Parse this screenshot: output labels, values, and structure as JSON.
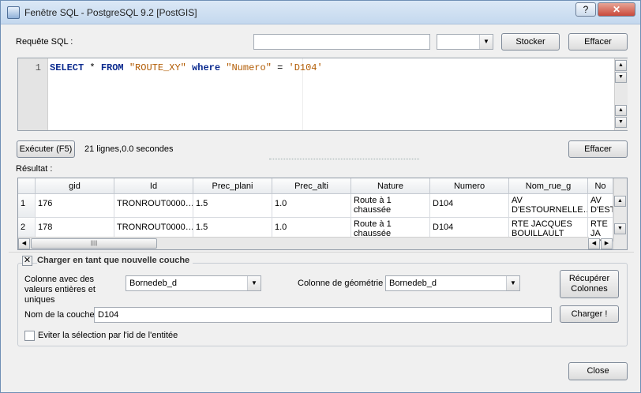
{
  "window": {
    "title": "Fenêtre SQL - PostgreSQL 9.2 [PostGIS]",
    "help_label": "?",
    "close_label": "✕"
  },
  "query": {
    "label": "Requête SQL :",
    "name_value": "",
    "combo_value": "",
    "store_label": "Stocker",
    "clear_label": "Effacer"
  },
  "editor": {
    "line_number": "1",
    "tokens": {
      "select": "SELECT",
      "star": " * ",
      "from": "FROM",
      "table": " \"ROUTE_XY\" ",
      "where": "where",
      "column": " \"Numero\" ",
      "eq": "= ",
      "value": "'D104'"
    }
  },
  "run": {
    "execute_label": "Exécuter (F5)",
    "status": "21 lignes,0.0 secondes",
    "clear_label": "Effacer"
  },
  "results": {
    "label": "Résultat :",
    "columns": [
      "gid",
      "Id",
      "Prec_plani",
      "Prec_alti",
      "Nature",
      "Numero",
      "Nom_rue_g",
      "No"
    ],
    "rows": [
      {
        "num": "1",
        "cells": [
          "176",
          "TRONROUT0000…",
          "1.5",
          "1.0",
          "Route à 1 chaussée",
          "D104",
          "AV D'ESTOURNELLE…",
          "AV D'ESTO"
        ]
      },
      {
        "num": "2",
        "cells": [
          "178",
          "TRONROUT0000…",
          "1.5",
          "1.0",
          "Route à 1 chaussée",
          "D104",
          "RTE JACQUES BOUILLAULT",
          "RTE JA BOUIL"
        ]
      }
    ]
  },
  "layer": {
    "group_label": "Charger en tant que nouvelle couche",
    "id_column_label": "Colonne avec des valeurs entières et uniques",
    "id_column_value": "Bornedeb_d",
    "geom_column_label": "Colonne de géométrie",
    "geom_column_value": "Bornedeb_d",
    "retrieve_label": "Récupérer Colonnes",
    "name_label": "Nom de la couche",
    "name_value": "D104",
    "load_label": "Charger !",
    "avoid_label": "Eviter la sélection par l'id de l'entitée"
  },
  "footer": {
    "close_label": "Close"
  }
}
